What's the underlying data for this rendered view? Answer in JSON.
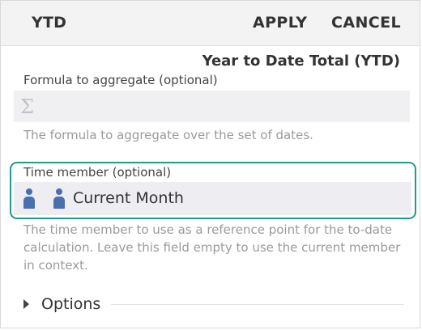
{
  "toolbar": {
    "title": "YTD",
    "apply_label": "APPLY",
    "cancel_label": "CANCEL"
  },
  "form": {
    "heading": "Year to Date Total (YTD)",
    "formula": {
      "label": "Formula to aggregate (optional)",
      "icon": "sigma-icon",
      "value": "",
      "help": "The formula to aggregate over the set of dates."
    },
    "time_member": {
      "label": "Time member (optional)",
      "icon": "member-icon",
      "value": "Current Month",
      "help": "The time member to use as a reference point for the to-date calculation. Leave this field empty to use the current member in context."
    },
    "options": {
      "label": "Options",
      "expanded": false
    }
  },
  "colors": {
    "accent_focus": "#1f9a8f",
    "member_icon": "#4a6fae"
  }
}
